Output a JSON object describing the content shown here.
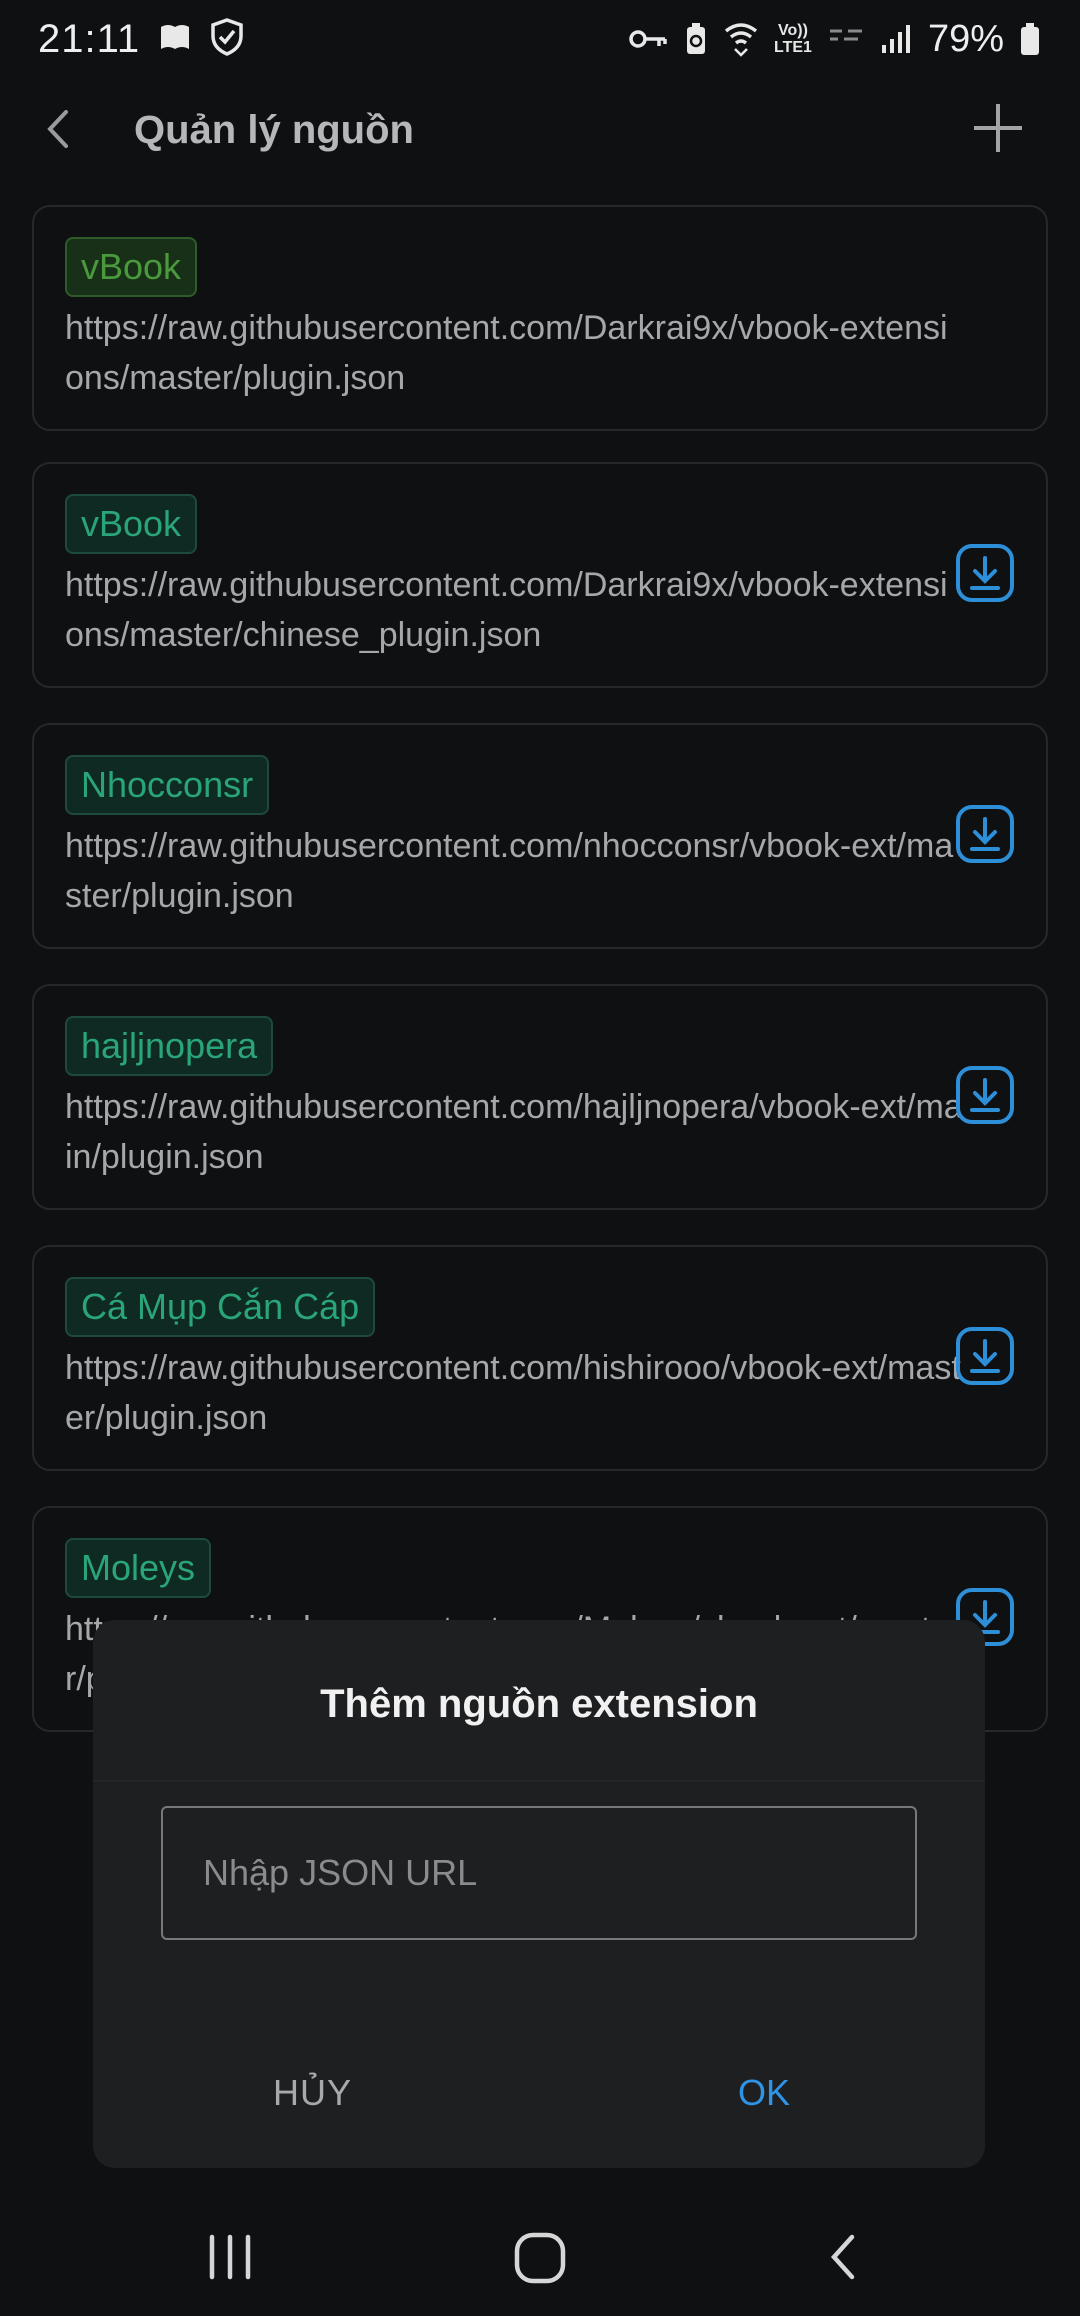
{
  "status_bar": {
    "time": "21:11",
    "battery": "79%",
    "network": [
      "Vo))",
      "LTE1"
    ]
  },
  "app_bar": {
    "title": "Quản lý nguồn",
    "back_icon": "chevron-left-icon",
    "add_icon": "plus-icon"
  },
  "sources": [
    {
      "tag": "vBook",
      "url": "https://raw.githubusercontent.com/Darkrai9x/vbook-extensions/master/plugin.json",
      "installed": true
    },
    {
      "tag": "vBook",
      "url": "https://raw.githubusercontent.com/Darkrai9x/vbook-extensions/master/chinese_plugin.json",
      "installed": false
    },
    {
      "tag": "Nhocconsr",
      "url": "https://raw.githubusercontent.com/nhocconsr/vbook-ext/master/plugin.json",
      "installed": false
    },
    {
      "tag": "hajljnopera",
      "url": "https://raw.githubusercontent.com/hajljnopera/vbook-ext/main/plugin.json",
      "installed": false
    },
    {
      "tag": "Cá Mụp Cắn Cáp",
      "url": "https://raw.githubusercontent.com/hishirooo/vbook-ext/master/plugin.json",
      "installed": false
    },
    {
      "tag": "Moleys",
      "url": "https://raw.githubusercontent.com/Moleys/vbook-ext/master/plugin.json",
      "installed": false
    }
  ],
  "dialog": {
    "title": "Thêm nguồn extension",
    "input_placeholder": "Nhập JSON URL",
    "input_value": "",
    "cancel_label": "HỦY",
    "ok_label": "OK"
  },
  "colors": {
    "background": "#0f1012",
    "tag_green": "#4a9a3d",
    "tag_teal": "#2aa57a",
    "accent_blue": "#2f93e6",
    "dialog_bg": "#1e1f21"
  }
}
